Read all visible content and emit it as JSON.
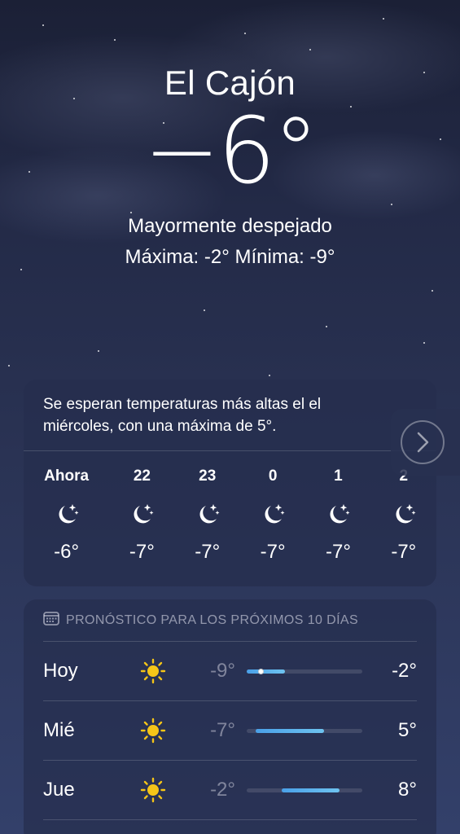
{
  "location": {
    "city": "El Cajón",
    "temperature": "−6°",
    "condition": "Mayormente despejado",
    "high_low": "Máxima:  -2°  Mínima: -9°"
  },
  "hourly": {
    "summary": "Se esperan temperaturas más altas el el miércoles, con una máxima de 5°.",
    "items": [
      {
        "time": "Ahora",
        "icon": "moon-stars-icon",
        "temp": "-6°"
      },
      {
        "time": "22",
        "icon": "moon-stars-icon",
        "temp": "-7°"
      },
      {
        "time": "23",
        "icon": "moon-stars-icon",
        "temp": "-7°"
      },
      {
        "time": "0",
        "icon": "moon-stars-icon",
        "temp": "-7°"
      },
      {
        "time": "1",
        "icon": "moon-stars-icon",
        "temp": "-7°"
      },
      {
        "time": "2",
        "icon": "moon-stars-icon",
        "temp": "-7°"
      }
    ]
  },
  "forecast": {
    "title": "PRONÓSTICO PARA LOS PRÓXIMOS 10 DÍAS",
    "days": [
      {
        "day": "Hoy",
        "icon": "sun-icon",
        "low": "-9°",
        "high": "-2°",
        "range_start": 0.0,
        "range_end": 0.33,
        "current_marker": 0.12
      },
      {
        "day": "Mié",
        "icon": "sun-icon",
        "low": "-7°",
        "high": "5°",
        "range_start": 0.08,
        "range_end": 0.67
      },
      {
        "day": "Jue",
        "icon": "sun-icon",
        "low": "-2°",
        "high": "8°",
        "range_start": 0.3,
        "range_end": 0.8
      }
    ]
  },
  "colors": {
    "sun": "#f5c518",
    "bar_gradient_start": "#4aa0e8",
    "bar_gradient_end": "#6ec3f0"
  }
}
